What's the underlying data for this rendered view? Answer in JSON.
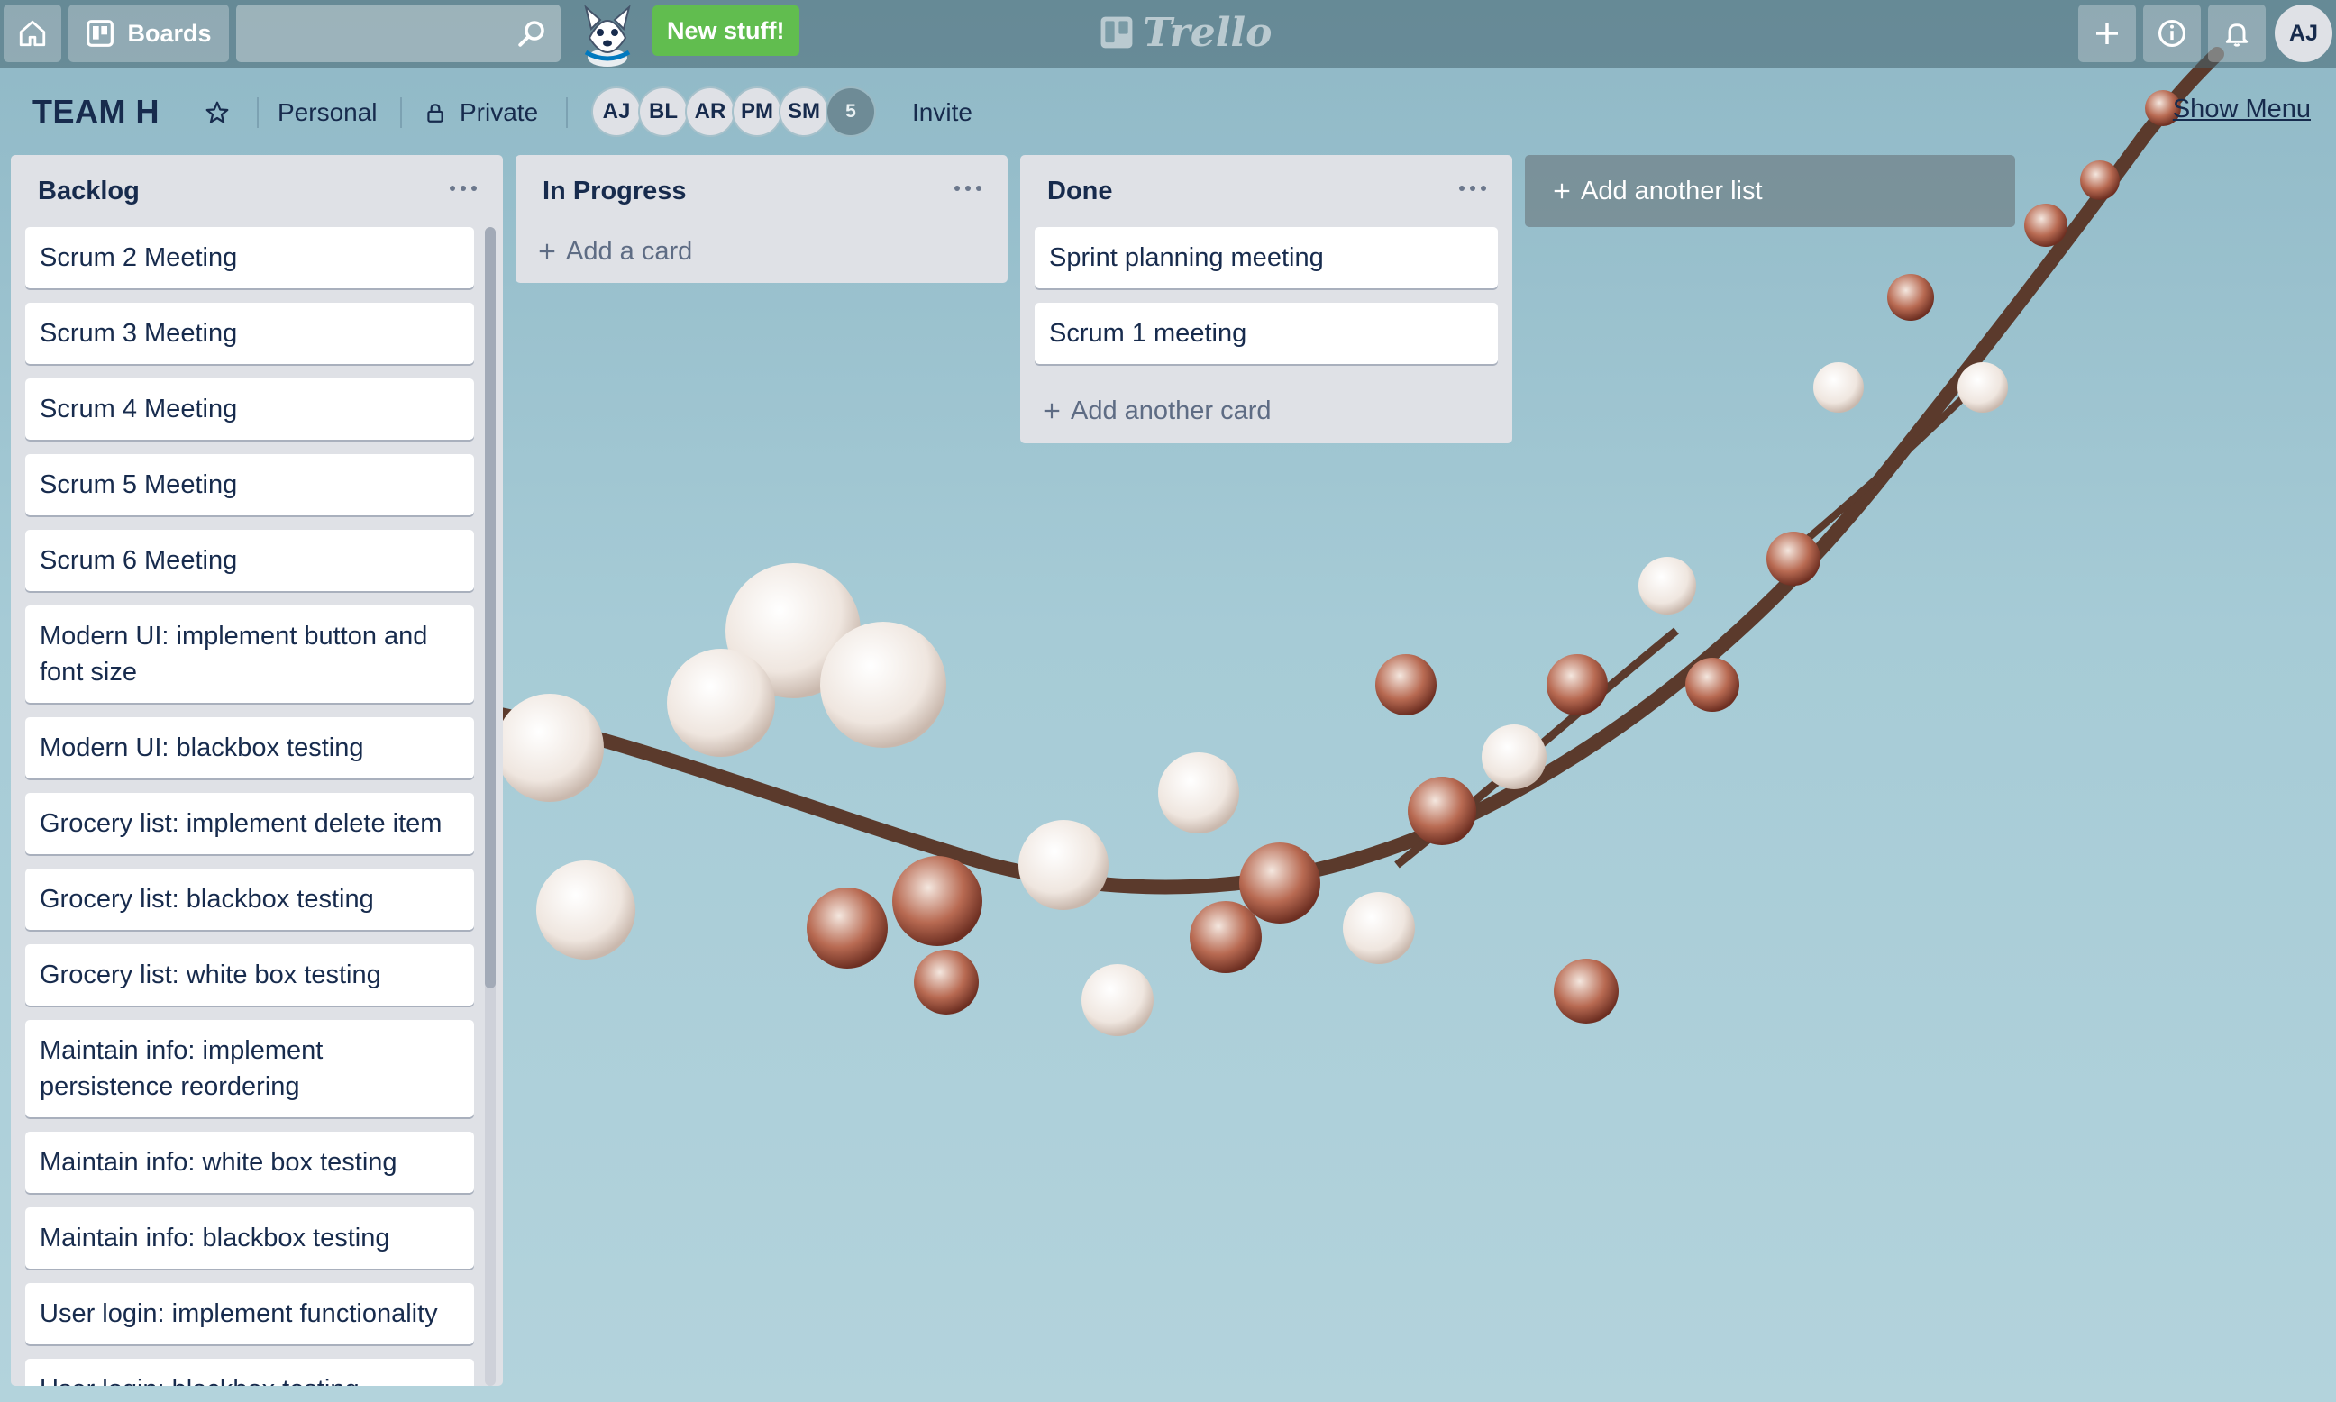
{
  "header": {
    "boards_label": "Boards",
    "search_placeholder": "",
    "new_stuff_label": "New stuff!",
    "logo_text": "Trello",
    "user_initials": "AJ"
  },
  "board": {
    "title": "TEAM H",
    "team_label": "Personal",
    "visibility_label": "Private",
    "members": [
      "AJ",
      "BL",
      "AR",
      "PM",
      "SM"
    ],
    "extra_members_count": "5",
    "invite_label": "Invite",
    "show_menu_label": "Show Menu"
  },
  "lists": [
    {
      "title": "Backlog",
      "cards": [
        "Scrum 2 Meeting",
        "Scrum 3 Meeting",
        "Scrum 4 Meeting",
        "Scrum 5 Meeting",
        "Scrum 6 Meeting",
        "Modern UI: implement button and font size",
        "Modern UI: blackbox testing",
        "Grocery list: implement delete item",
        "Grocery list: blackbox testing",
        "Grocery list: white box testing",
        "Maintain info: implement persistence reordering",
        "Maintain info: white box testing",
        "Maintain info: blackbox testing",
        "User login: implement functionality",
        "User login: blackbox testing"
      ]
    },
    {
      "title": "In Progress",
      "cards": [],
      "add_label": "Add a card"
    },
    {
      "title": "Done",
      "cards": [
        "Sprint planning meeting",
        "Scrum 1 meeting"
      ],
      "add_label": "Add another card"
    }
  ],
  "add_list_label": "Add another list",
  "colors": {
    "accent_green": "#61bd4f",
    "list_bg": "#dfe1e6",
    "text": "#172b4d"
  }
}
